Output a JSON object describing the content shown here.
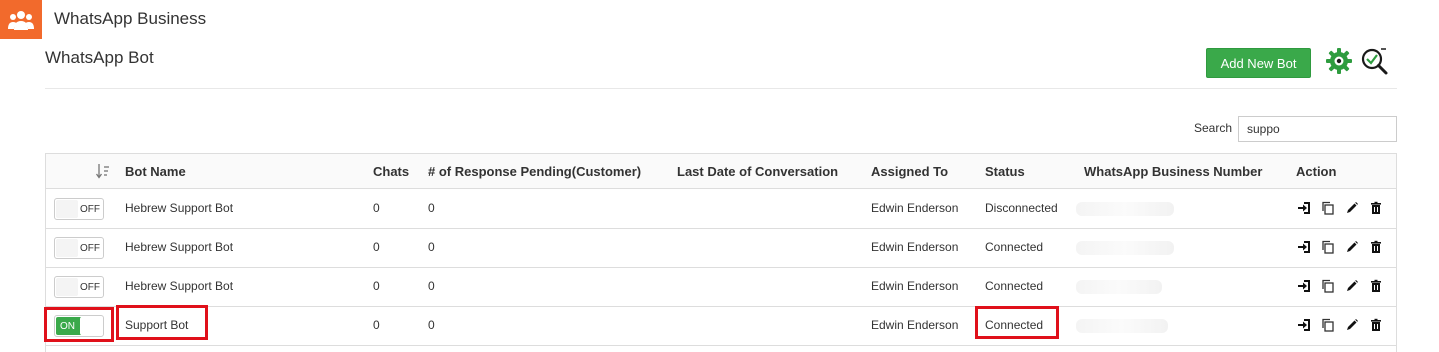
{
  "app": {
    "title": "WhatsApp Business",
    "logo_icon": "users-group-icon",
    "brand_color": "#f26a2c"
  },
  "page": {
    "title": "WhatsApp Bot",
    "add_button_label": "Add New Bot",
    "add_button_color": "#3aa94a"
  },
  "search": {
    "label": "Search",
    "value": "suppo"
  },
  "table": {
    "headers": {
      "bot_name": "Bot Name",
      "chats": "Chats",
      "pending": "# of Response Pending(Customer)",
      "last_date": "Last Date of Conversation",
      "assigned_to": "Assigned To",
      "status": "Status",
      "number": "WhatsApp Business Number",
      "action": "Action"
    },
    "rows": [
      {
        "toggle": "OFF",
        "bot_name": "Hebrew Support Bot",
        "chats": "0",
        "pending": "0",
        "last_date": "",
        "assigned_to": "Edwin Enderson",
        "status": "Disconnected"
      },
      {
        "toggle": "OFF",
        "bot_name": "Hebrew Support Bot",
        "chats": "0",
        "pending": "0",
        "last_date": "",
        "assigned_to": "Edwin Enderson",
        "status": "Connected"
      },
      {
        "toggle": "OFF",
        "bot_name": "Hebrew Support Bot",
        "chats": "0",
        "pending": "0",
        "last_date": "",
        "assigned_to": "Edwin Enderson",
        "status": "Connected"
      },
      {
        "toggle": "ON",
        "bot_name": "Support Bot",
        "chats": "0",
        "pending": "0",
        "last_date": "",
        "assigned_to": "Edwin Enderson",
        "status": "Connected"
      }
    ]
  },
  "icons": {
    "settings": "gear-icon",
    "search_check": "search-check-icon",
    "sort": "sort-icon",
    "actions": [
      "login-icon",
      "copy-icon",
      "edit-icon",
      "trash-icon"
    ]
  },
  "highlight_color": "#e0101a"
}
